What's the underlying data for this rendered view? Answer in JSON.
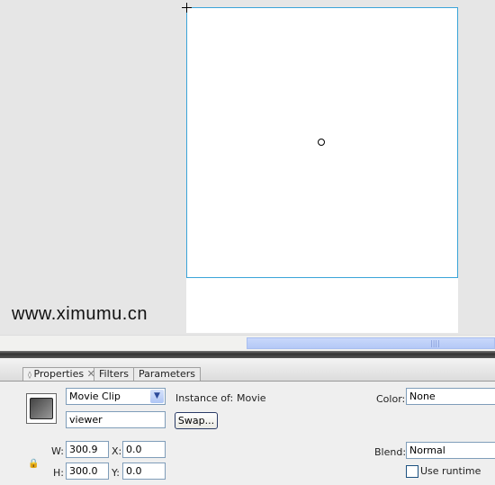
{
  "watermark": "www.ximumu.cn",
  "tabs": [
    {
      "label": "Properties",
      "active": true
    },
    {
      "label": "Filters"
    },
    {
      "label": "Parameters"
    }
  ],
  "properties": {
    "symbol_type": "Movie Clip",
    "instance_name": "viewer",
    "instance_of_label": "Instance of:",
    "instance_of_value": "Movie",
    "swap_label": "Swap...",
    "w_label": "W:",
    "w_value": "300.9",
    "h_label": "H:",
    "h_value": "300.0",
    "x_label": "X:",
    "x_value": "0.0",
    "y_label": "Y:",
    "y_value": "0.0",
    "color_label": "Color:",
    "color_value": "None",
    "blend_label": "Blend:",
    "blend_value": "Normal",
    "runtime_label": "Use runtime"
  },
  "colors": {
    "selection": "#3aa4d8",
    "scroll_thumb": "#c0d2f9"
  }
}
